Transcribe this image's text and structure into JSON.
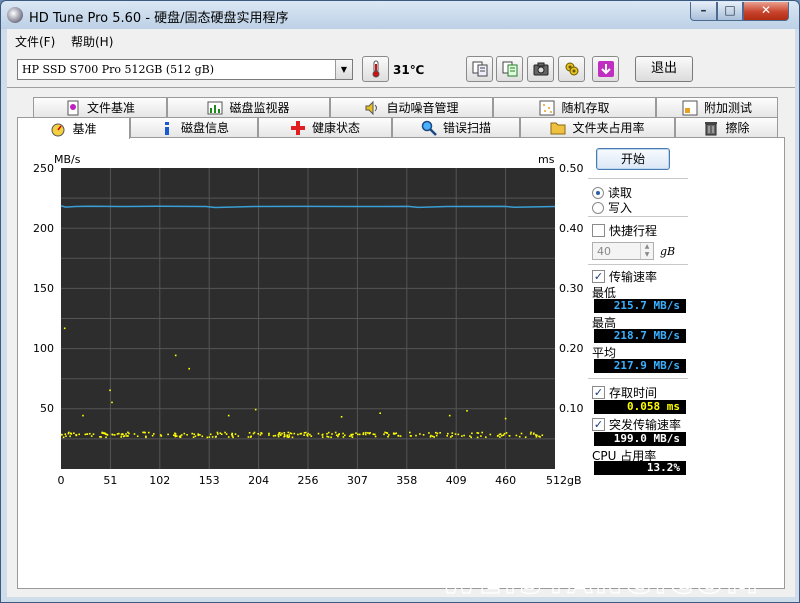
{
  "window": {
    "title": "HD Tune Pro 5.60 - 硬盘/固态硬盘实用程序"
  },
  "menu": [
    "文件(F)",
    "帮助(H)"
  ],
  "toolbar": {
    "drive": "HP SSD S700 Pro 512GB (512 gB)",
    "temperature": "31℃",
    "exit_label": "退出",
    "icons": [
      "copy-icon",
      "copy-all-icon",
      "camera-icon",
      "tools-icon",
      "download-icon"
    ]
  },
  "tabs_top": [
    "文件基准",
    "磁盘监视器",
    "自动噪音管理",
    "随机存取",
    "附加测试"
  ],
  "tabs_bottom": [
    "基准",
    "磁盘信息",
    "健康状态",
    "错误扫描",
    "文件夹占用率",
    "擦除"
  ],
  "active_tab": "基准",
  "side": {
    "start_label": "开始",
    "read_label": "读取",
    "write_label": "写入",
    "short_stroke_label": "快捷行程",
    "short_stroke_value": "40",
    "short_stroke_unit": "gB",
    "transfer_rate_label": "传输速率",
    "min_label": "最低",
    "min_value": "215.7 MB/s",
    "max_label": "最高",
    "max_value": "218.7 MB/s",
    "avg_label": "平均",
    "avg_value": "217.9 MB/s",
    "access_time_label": "存取时间",
    "access_time_value": "0.058 ms",
    "burst_label": "突发传输速率",
    "burst_value": "199.0 MB/s",
    "cpu_label": "CPU 占用率",
    "cpu_value": "13.2%"
  },
  "chart_data": {
    "type": "line",
    "ylabel": "MB/s",
    "y2label": "ms",
    "ylim": [
      0,
      250
    ],
    "y2lim": [
      0,
      0.5
    ],
    "yticks": [
      "250",
      "200",
      "150",
      "100",
      "50"
    ],
    "y2ticks": [
      "0.50",
      "0.40",
      "0.30",
      "0.20",
      "0.10"
    ],
    "xticks": [
      "0",
      "51",
      "102",
      "153",
      "204",
      "256",
      "307",
      "358",
      "409",
      "460",
      "512gB"
    ],
    "xlim": [
      0,
      512
    ],
    "series": [
      {
        "color": "#3a9fd6",
        "x": [
          0,
          5,
          15,
          30,
          60,
          100,
          150,
          160,
          200,
          250,
          300,
          360,
          370,
          400,
          460,
          470,
          512
        ],
        "y": [
          218.5,
          217.5,
          218.0,
          218.3,
          218.0,
          218.2,
          218.0,
          217.2,
          218.0,
          218.1,
          218.0,
          218.1,
          217.3,
          218.0,
          218.1,
          217.4,
          218.0
        ]
      },
      {
        "color": "#ffff00",
        "kind": "access_time_scatter",
        "baseline_ms": 0.058,
        "outliers_x": [
          3,
          22,
          50,
          52,
          118,
          132,
          173,
          201,
          290,
          330,
          402,
          420,
          460
        ],
        "outliers_ms": [
          0.235,
          0.09,
          0.132,
          0.112,
          0.19,
          0.168,
          0.09,
          0.1,
          0.088,
          0.094,
          0.09,
          0.098,
          0.085
        ]
      }
    ]
  }
}
